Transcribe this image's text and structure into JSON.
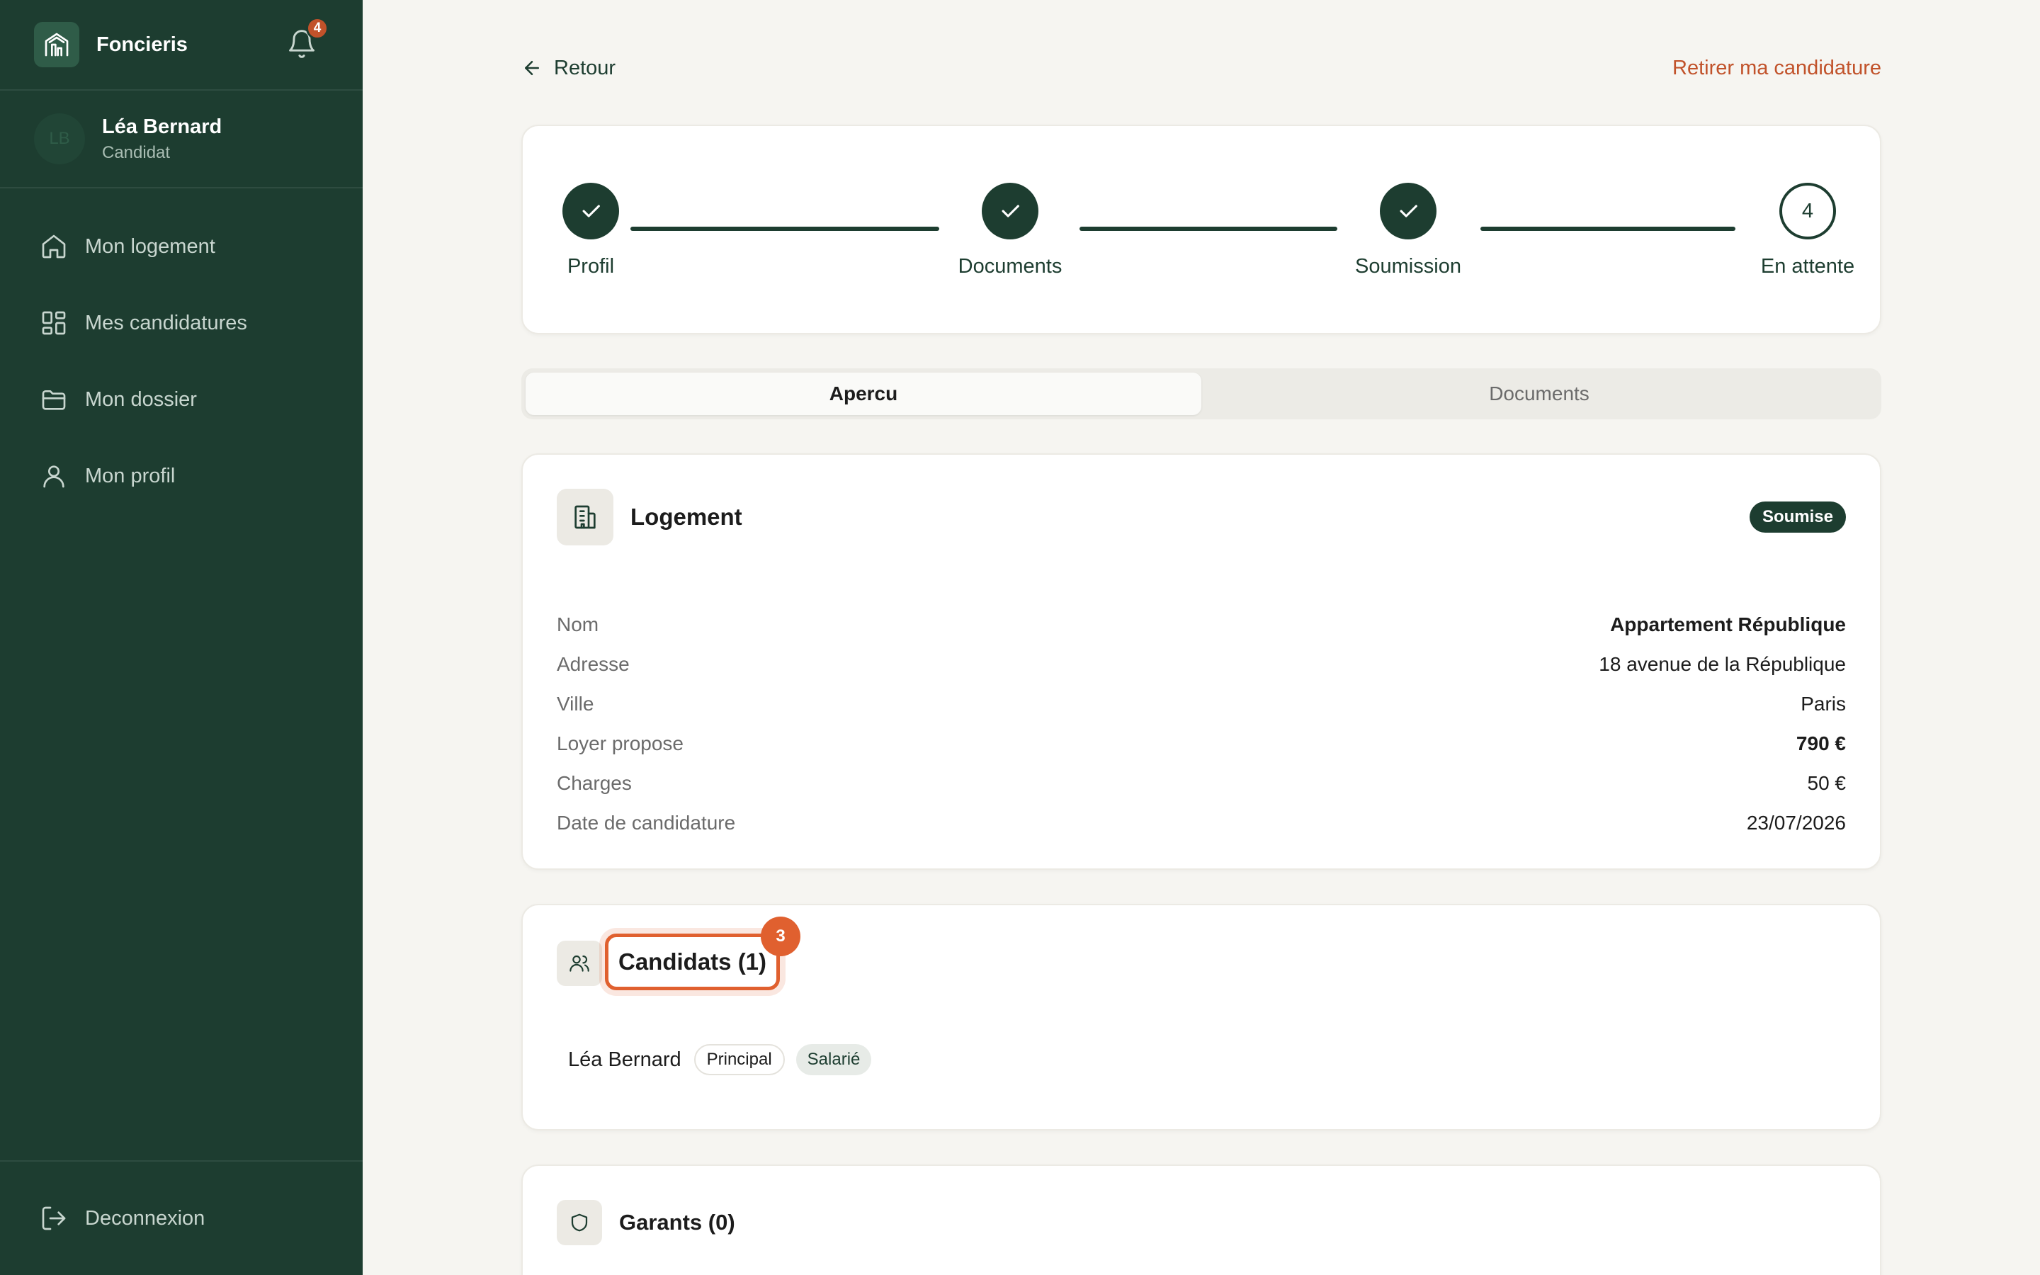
{
  "app": {
    "brand": "Foncieris",
    "notifications": "4"
  },
  "user": {
    "initials": "LB",
    "name": "Léa Bernard",
    "role": "Candidat"
  },
  "nav": [
    {
      "label": "Mon logement",
      "icon": "home-icon"
    },
    {
      "label": "Mes candidatures",
      "icon": "grid-icon"
    },
    {
      "label": "Mon dossier",
      "icon": "folder-icon"
    },
    {
      "label": "Mon profil",
      "icon": "user-icon"
    }
  ],
  "logout": "Deconnexion",
  "topbar": {
    "back": "Retour",
    "withdraw": "Retirer ma candidature"
  },
  "steps": [
    {
      "label": "Profil",
      "state": "done"
    },
    {
      "label": "Documents",
      "state": "done"
    },
    {
      "label": "Soumission",
      "state": "done"
    },
    {
      "label": "En attente",
      "state": "pending",
      "number": "4"
    }
  ],
  "tabs": [
    {
      "label": "Apercu",
      "active": true
    },
    {
      "label": "Documents",
      "active": false
    }
  ],
  "logement": {
    "title": "Logement",
    "status": "Soumise",
    "rows": [
      {
        "key": "Nom",
        "value": "Appartement République"
      },
      {
        "key": "Adresse",
        "value": "18 avenue de la République"
      },
      {
        "key": "Ville",
        "value": "Paris"
      },
      {
        "key": "Loyer propose",
        "value": "790 €"
      },
      {
        "key": "Charges",
        "value": "50 €"
      },
      {
        "key": "Date de candidature",
        "value": "23/07/2026"
      }
    ]
  },
  "candidats": {
    "title": "Candidats (1)",
    "badge": "3",
    "list": [
      {
        "name": "Léa Bernard",
        "tags": [
          "Principal",
          "Salarié"
        ]
      }
    ]
  },
  "garants": {
    "title": "Garants (0)"
  },
  "colors": {
    "sidebar": "#1d3d30",
    "accent": "#c1522a",
    "highlight": "#e0602f",
    "background": "#f6f5f1"
  }
}
